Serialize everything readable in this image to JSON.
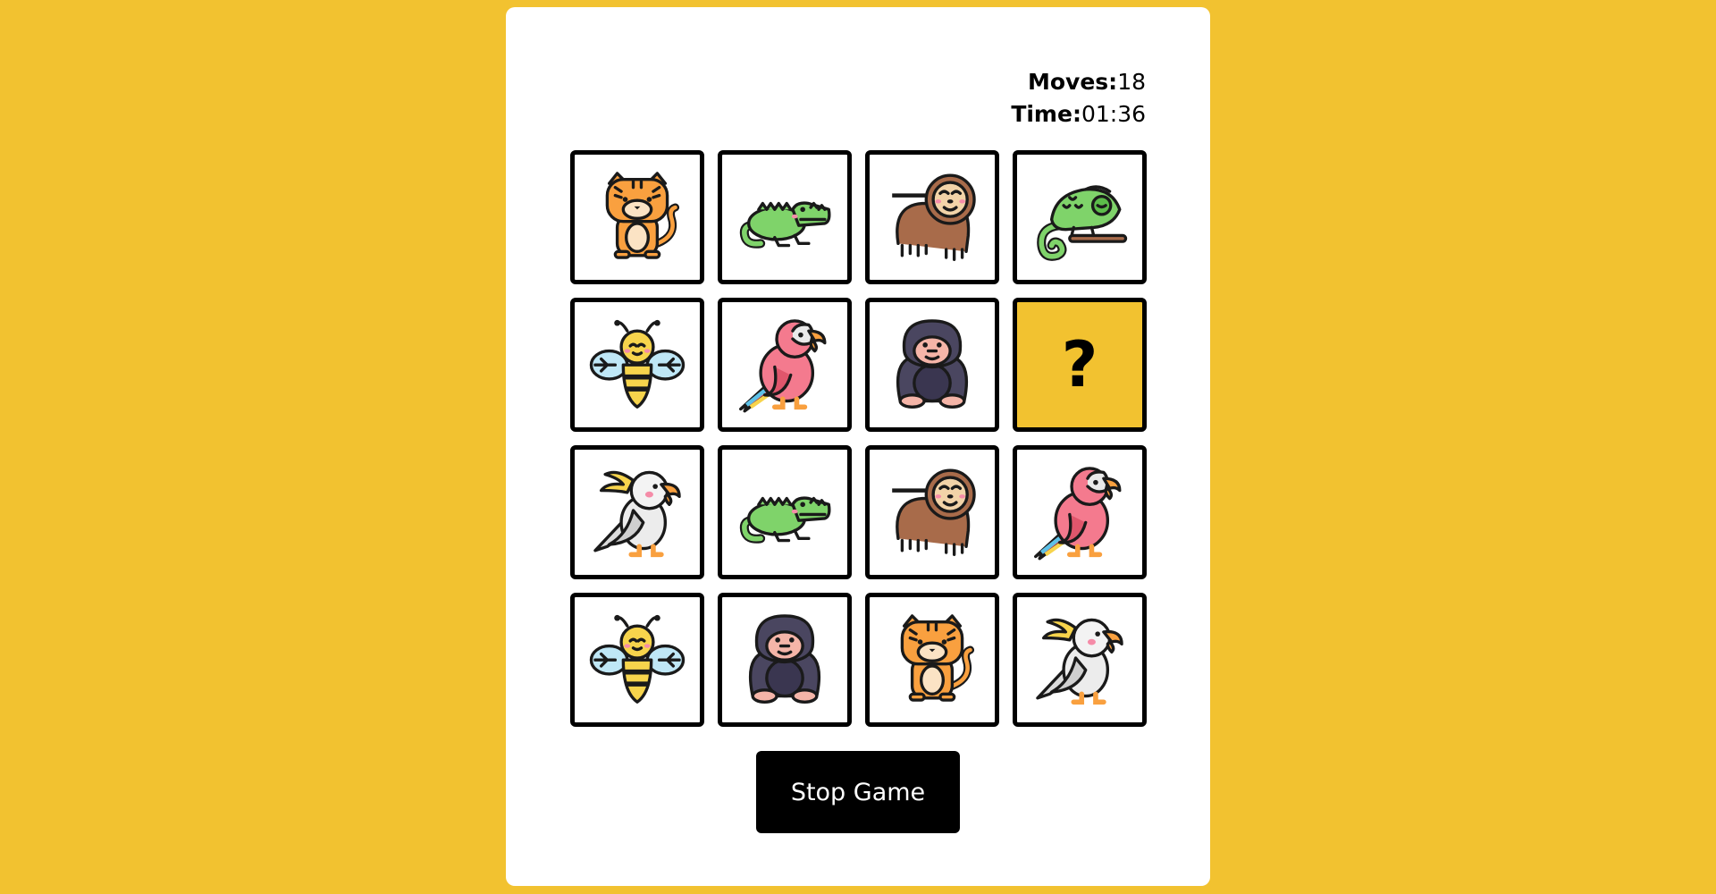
{
  "stats": {
    "moves_label": "Moves:",
    "moves_value": "18",
    "time_label": "Time:",
    "time_value": "01:36"
  },
  "board": {
    "cards": [
      {
        "animal": "tiger",
        "revealed": true
      },
      {
        "animal": "crocodile",
        "revealed": true
      },
      {
        "animal": "sloth",
        "revealed": true
      },
      {
        "animal": "chameleon",
        "revealed": true
      },
      {
        "animal": "bee",
        "revealed": true
      },
      {
        "animal": "macaw",
        "revealed": true
      },
      {
        "animal": "gorilla",
        "revealed": true
      },
      {
        "animal": "hidden",
        "revealed": false,
        "label": "?"
      },
      {
        "animal": "cockatoo",
        "revealed": true
      },
      {
        "animal": "crocodile",
        "revealed": true
      },
      {
        "animal": "sloth",
        "revealed": true
      },
      {
        "animal": "macaw",
        "revealed": true
      },
      {
        "animal": "bee",
        "revealed": true
      },
      {
        "animal": "gorilla",
        "revealed": true
      },
      {
        "animal": "tiger",
        "revealed": true
      },
      {
        "animal": "cockatoo",
        "revealed": true
      }
    ]
  },
  "controls": {
    "stop_label": "Stop Game"
  },
  "colors": {
    "background": "#f2c230",
    "panel": "#ffffff",
    "card_border": "#000000",
    "hidden_card": "#f2c230",
    "button": "#000000"
  }
}
